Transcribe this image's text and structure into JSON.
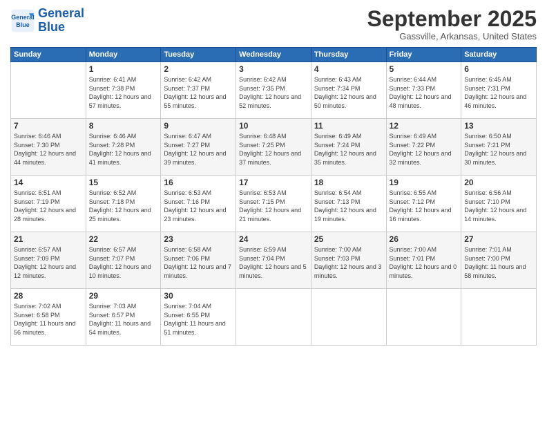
{
  "header": {
    "logo_line1": "General",
    "logo_line2": "Blue",
    "month_title": "September 2025",
    "location": "Gassville, Arkansas, United States"
  },
  "days_of_week": [
    "Sunday",
    "Monday",
    "Tuesday",
    "Wednesday",
    "Thursday",
    "Friday",
    "Saturday"
  ],
  "weeks": [
    [
      {
        "num": "",
        "sunrise": "",
        "sunset": "",
        "daylight": "",
        "empty": true
      },
      {
        "num": "1",
        "sunrise": "Sunrise: 6:41 AM",
        "sunset": "Sunset: 7:38 PM",
        "daylight": "Daylight: 12 hours and 57 minutes."
      },
      {
        "num": "2",
        "sunrise": "Sunrise: 6:42 AM",
        "sunset": "Sunset: 7:37 PM",
        "daylight": "Daylight: 12 hours and 55 minutes."
      },
      {
        "num": "3",
        "sunrise": "Sunrise: 6:42 AM",
        "sunset": "Sunset: 7:35 PM",
        "daylight": "Daylight: 12 hours and 52 minutes."
      },
      {
        "num": "4",
        "sunrise": "Sunrise: 6:43 AM",
        "sunset": "Sunset: 7:34 PM",
        "daylight": "Daylight: 12 hours and 50 minutes."
      },
      {
        "num": "5",
        "sunrise": "Sunrise: 6:44 AM",
        "sunset": "Sunset: 7:33 PM",
        "daylight": "Daylight: 12 hours and 48 minutes."
      },
      {
        "num": "6",
        "sunrise": "Sunrise: 6:45 AM",
        "sunset": "Sunset: 7:31 PM",
        "daylight": "Daylight: 12 hours and 46 minutes."
      }
    ],
    [
      {
        "num": "7",
        "sunrise": "Sunrise: 6:46 AM",
        "sunset": "Sunset: 7:30 PM",
        "daylight": "Daylight: 12 hours and 44 minutes."
      },
      {
        "num": "8",
        "sunrise": "Sunrise: 6:46 AM",
        "sunset": "Sunset: 7:28 PM",
        "daylight": "Daylight: 12 hours and 41 minutes."
      },
      {
        "num": "9",
        "sunrise": "Sunrise: 6:47 AM",
        "sunset": "Sunset: 7:27 PM",
        "daylight": "Daylight: 12 hours and 39 minutes."
      },
      {
        "num": "10",
        "sunrise": "Sunrise: 6:48 AM",
        "sunset": "Sunset: 7:25 PM",
        "daylight": "Daylight: 12 hours and 37 minutes."
      },
      {
        "num": "11",
        "sunrise": "Sunrise: 6:49 AM",
        "sunset": "Sunset: 7:24 PM",
        "daylight": "Daylight: 12 hours and 35 minutes."
      },
      {
        "num": "12",
        "sunrise": "Sunrise: 6:49 AM",
        "sunset": "Sunset: 7:22 PM",
        "daylight": "Daylight: 12 hours and 32 minutes."
      },
      {
        "num": "13",
        "sunrise": "Sunrise: 6:50 AM",
        "sunset": "Sunset: 7:21 PM",
        "daylight": "Daylight: 12 hours and 30 minutes."
      }
    ],
    [
      {
        "num": "14",
        "sunrise": "Sunrise: 6:51 AM",
        "sunset": "Sunset: 7:19 PM",
        "daylight": "Daylight: 12 hours and 28 minutes."
      },
      {
        "num": "15",
        "sunrise": "Sunrise: 6:52 AM",
        "sunset": "Sunset: 7:18 PM",
        "daylight": "Daylight: 12 hours and 25 minutes."
      },
      {
        "num": "16",
        "sunrise": "Sunrise: 6:53 AM",
        "sunset": "Sunset: 7:16 PM",
        "daylight": "Daylight: 12 hours and 23 minutes."
      },
      {
        "num": "17",
        "sunrise": "Sunrise: 6:53 AM",
        "sunset": "Sunset: 7:15 PM",
        "daylight": "Daylight: 12 hours and 21 minutes."
      },
      {
        "num": "18",
        "sunrise": "Sunrise: 6:54 AM",
        "sunset": "Sunset: 7:13 PM",
        "daylight": "Daylight: 12 hours and 19 minutes."
      },
      {
        "num": "19",
        "sunrise": "Sunrise: 6:55 AM",
        "sunset": "Sunset: 7:12 PM",
        "daylight": "Daylight: 12 hours and 16 minutes."
      },
      {
        "num": "20",
        "sunrise": "Sunrise: 6:56 AM",
        "sunset": "Sunset: 7:10 PM",
        "daylight": "Daylight: 12 hours and 14 minutes."
      }
    ],
    [
      {
        "num": "21",
        "sunrise": "Sunrise: 6:57 AM",
        "sunset": "Sunset: 7:09 PM",
        "daylight": "Daylight: 12 hours and 12 minutes."
      },
      {
        "num": "22",
        "sunrise": "Sunrise: 6:57 AM",
        "sunset": "Sunset: 7:07 PM",
        "daylight": "Daylight: 12 hours and 10 minutes."
      },
      {
        "num": "23",
        "sunrise": "Sunrise: 6:58 AM",
        "sunset": "Sunset: 7:06 PM",
        "daylight": "Daylight: 12 hours and 7 minutes."
      },
      {
        "num": "24",
        "sunrise": "Sunrise: 6:59 AM",
        "sunset": "Sunset: 7:04 PM",
        "daylight": "Daylight: 12 hours and 5 minutes."
      },
      {
        "num": "25",
        "sunrise": "Sunrise: 7:00 AM",
        "sunset": "Sunset: 7:03 PM",
        "daylight": "Daylight: 12 hours and 3 minutes."
      },
      {
        "num": "26",
        "sunrise": "Sunrise: 7:00 AM",
        "sunset": "Sunset: 7:01 PM",
        "daylight": "Daylight: 12 hours and 0 minutes."
      },
      {
        "num": "27",
        "sunrise": "Sunrise: 7:01 AM",
        "sunset": "Sunset: 7:00 PM",
        "daylight": "Daylight: 11 hours and 58 minutes."
      }
    ],
    [
      {
        "num": "28",
        "sunrise": "Sunrise: 7:02 AM",
        "sunset": "Sunset: 6:58 PM",
        "daylight": "Daylight: 11 hours and 56 minutes."
      },
      {
        "num": "29",
        "sunrise": "Sunrise: 7:03 AM",
        "sunset": "Sunset: 6:57 PM",
        "daylight": "Daylight: 11 hours and 54 minutes."
      },
      {
        "num": "30",
        "sunrise": "Sunrise: 7:04 AM",
        "sunset": "Sunset: 6:55 PM",
        "daylight": "Daylight: 11 hours and 51 minutes."
      },
      {
        "num": "",
        "sunrise": "",
        "sunset": "",
        "daylight": "",
        "empty": true
      },
      {
        "num": "",
        "sunrise": "",
        "sunset": "",
        "daylight": "",
        "empty": true
      },
      {
        "num": "",
        "sunrise": "",
        "sunset": "",
        "daylight": "",
        "empty": true
      },
      {
        "num": "",
        "sunrise": "",
        "sunset": "",
        "daylight": "",
        "empty": true
      }
    ]
  ]
}
